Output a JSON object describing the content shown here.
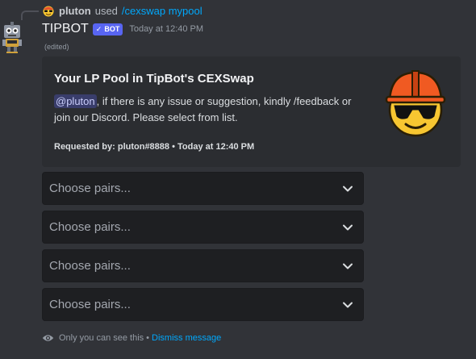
{
  "reply": {
    "username": "pluton",
    "used_text": "used",
    "command": "/cexswap mypool"
  },
  "message": {
    "author": "TIPBOT",
    "bot_tag": "BOT",
    "timestamp": "Today at 12:40 PM",
    "edited": "(edited)"
  },
  "embed": {
    "title": "Your LP Pool in TipBot's CEXSwap",
    "mention": "@pluton",
    "description": ", if there is any issue or suggestion, kindly /feedback or join our Discord. Please select from list.",
    "footer": "Requested by: pluton#8888 • Today at 12:40 PM"
  },
  "selects": [
    {
      "placeholder": "Choose pairs..."
    },
    {
      "placeholder": "Choose pairs..."
    },
    {
      "placeholder": "Choose pairs..."
    },
    {
      "placeholder": "Choose pairs..."
    }
  ],
  "ephemeral": {
    "notice": "Only you can see this",
    "separator": "•",
    "dismiss": "Dismiss message"
  },
  "colors": {
    "background": "#313338",
    "embed_bg": "#2b2d31",
    "select_bg": "#1e1f22",
    "blurple": "#5865f2",
    "link": "#00a8fc"
  },
  "icons": [
    "emoji-avatar-icon",
    "robot-avatar-icon",
    "verified-check-icon",
    "construction-emoji-icon",
    "chevron-down-icon",
    "eye-icon"
  ]
}
